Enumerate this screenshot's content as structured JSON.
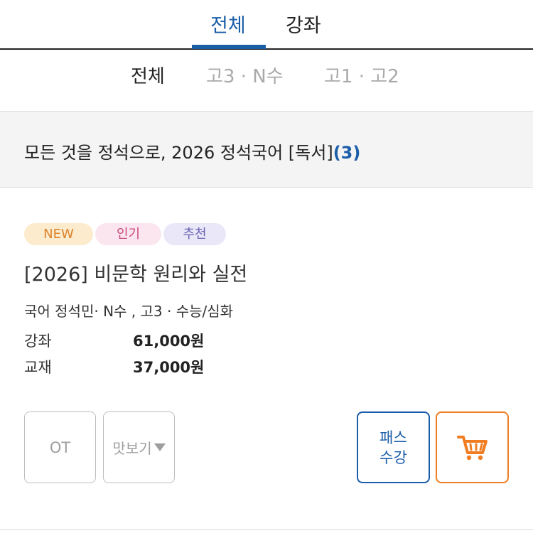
{
  "top_tabs": [
    {
      "label": "전체",
      "active": true
    },
    {
      "label": "강좌",
      "active": false
    }
  ],
  "sub_tabs": [
    {
      "label": "전체",
      "active": true
    },
    {
      "label": "고3 · N수",
      "active": false
    },
    {
      "label": "고1 · 고2",
      "active": false
    }
  ],
  "section": {
    "title": "모든 것을 정석으로, 2026 정석국어 [독서]",
    "count": "(3)"
  },
  "course": {
    "badges": {
      "new": "NEW",
      "hot": "인기",
      "recommend": "추천"
    },
    "title": "[2026] 비문학 원리와 실전",
    "meta": "국어 정석민· N수 , 고3 · 수능/심화",
    "prices": [
      {
        "label": "강좌",
        "value": "61,000원"
      },
      {
        "label": "교재",
        "value": "37,000원"
      }
    ],
    "buttons": {
      "ot": "OT",
      "preview": "맛보기",
      "pass_line1": "패스",
      "pass_line2": "수강",
      "cart_icon": "cart-icon"
    }
  },
  "colors": {
    "accent_blue": "#1b5ea8",
    "cart_orange": "#f07d22",
    "badge_new_bg": "#fdebcd",
    "badge_hot_bg": "#fbe6ef",
    "badge_rec_bg": "#e9e7f8"
  }
}
